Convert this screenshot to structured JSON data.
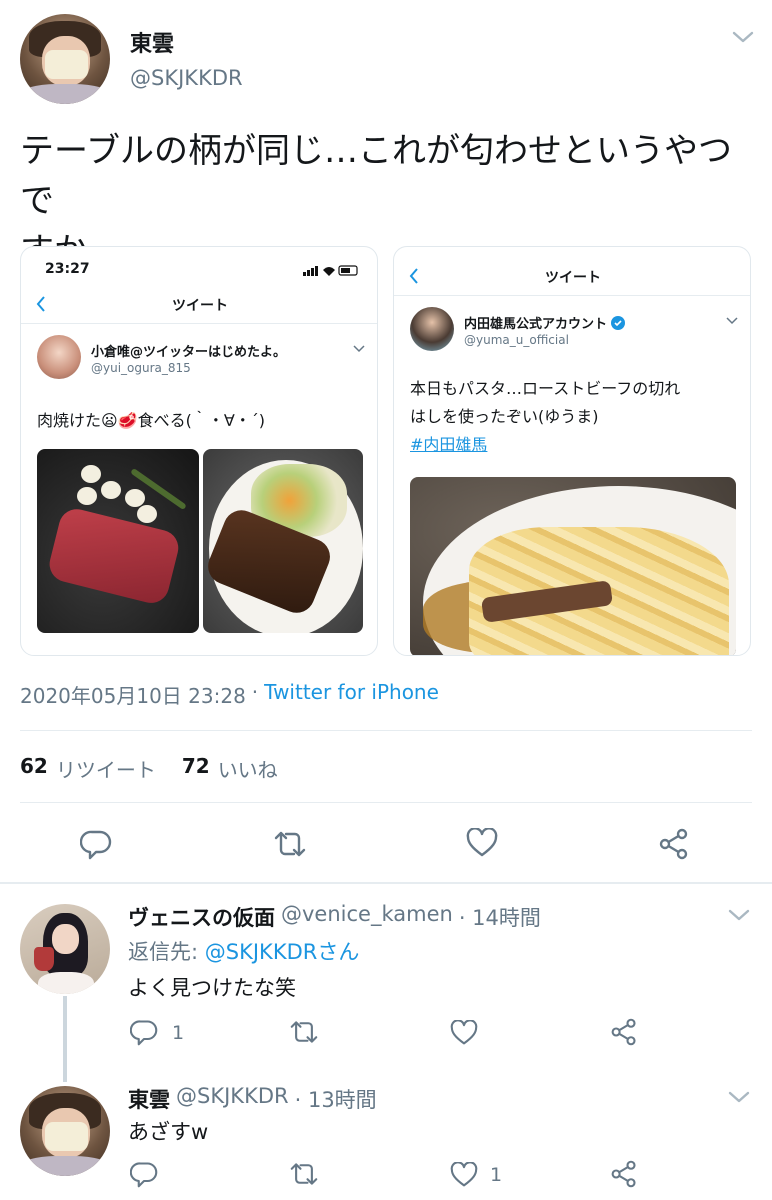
{
  "tweet": {
    "author_name": "東雲",
    "author_handle": "@SKJKKDR",
    "text_line1": "テーブルの柄が同じ…これが匂わせというやつで",
    "text_line2": "すか。",
    "timestamp": "2020年05月10日 23:28",
    "separator": "·",
    "client": "Twitter for iPhone",
    "retweets_count": "62",
    "retweets_label": "リツイート",
    "likes_count": "72",
    "likes_label": "いいね"
  },
  "embed_left": {
    "status_time": "23:27",
    "header_title": "ツイート",
    "author_name": "小倉唯@ツイッターはじめたよ。",
    "author_handle": "@yui_ogura_815",
    "text": "肉焼けた😦🥩食べる(｀・∀・´)"
  },
  "embed_right": {
    "header_title": "ツイート",
    "author_name": "内田雄馬公式アカウント",
    "author_handle": "@yuma_u_official",
    "text_line1": "本日もパスタ…ローストビーフの切れ",
    "text_line2": "はしを使ったぞい(ゆうま)",
    "hashtag": "#内田雄馬"
  },
  "replies": [
    {
      "author_name": "ヴェニスの仮面",
      "author_handle": "@venice_kamen",
      "time": "· 14時間",
      "reply_to_prefix": "返信先: ",
      "reply_to_handle": "@SKJKKDRさん",
      "text": "よく見つけたな笑",
      "reply_count": "1",
      "like_count": ""
    },
    {
      "author_name": "東雲",
      "author_handle": "@SKJKKDR",
      "time": "· 13時間",
      "text": "あざすw",
      "reply_count": "",
      "like_count": "1"
    }
  ],
  "icons": [
    "chevron-down-icon",
    "reply-icon",
    "retweet-icon",
    "like-icon",
    "share-icon",
    "verified-icon",
    "back-icon"
  ],
  "colors": {
    "link": "#1b95e0",
    "muted": "#657786",
    "border": "#e6ecf0"
  }
}
